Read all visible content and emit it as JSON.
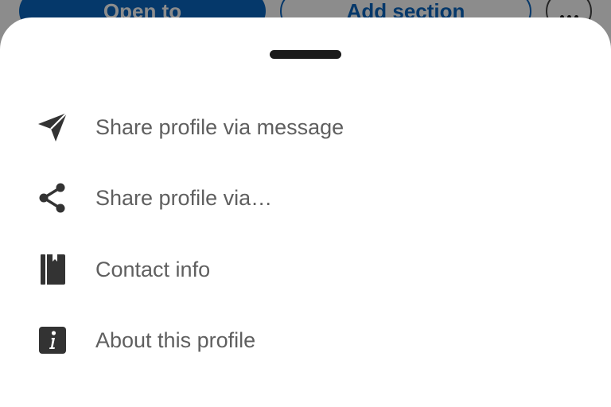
{
  "background": {
    "primary_button_label": "Open to",
    "secondary_button_label": "Add section",
    "more_button_label": "More"
  },
  "sheet": {
    "items": [
      {
        "label": "Share profile via message",
        "icon": "send-icon"
      },
      {
        "label": "Share profile via…",
        "icon": "share-icon"
      },
      {
        "label": "Contact info",
        "icon": "contact-book-icon"
      },
      {
        "label": "About this profile",
        "icon": "info-icon"
      }
    ]
  },
  "colors": {
    "accent": "#0a66c2",
    "icon": "#333333",
    "label": "#5f5f5f",
    "handle": "#1a1a1a"
  }
}
